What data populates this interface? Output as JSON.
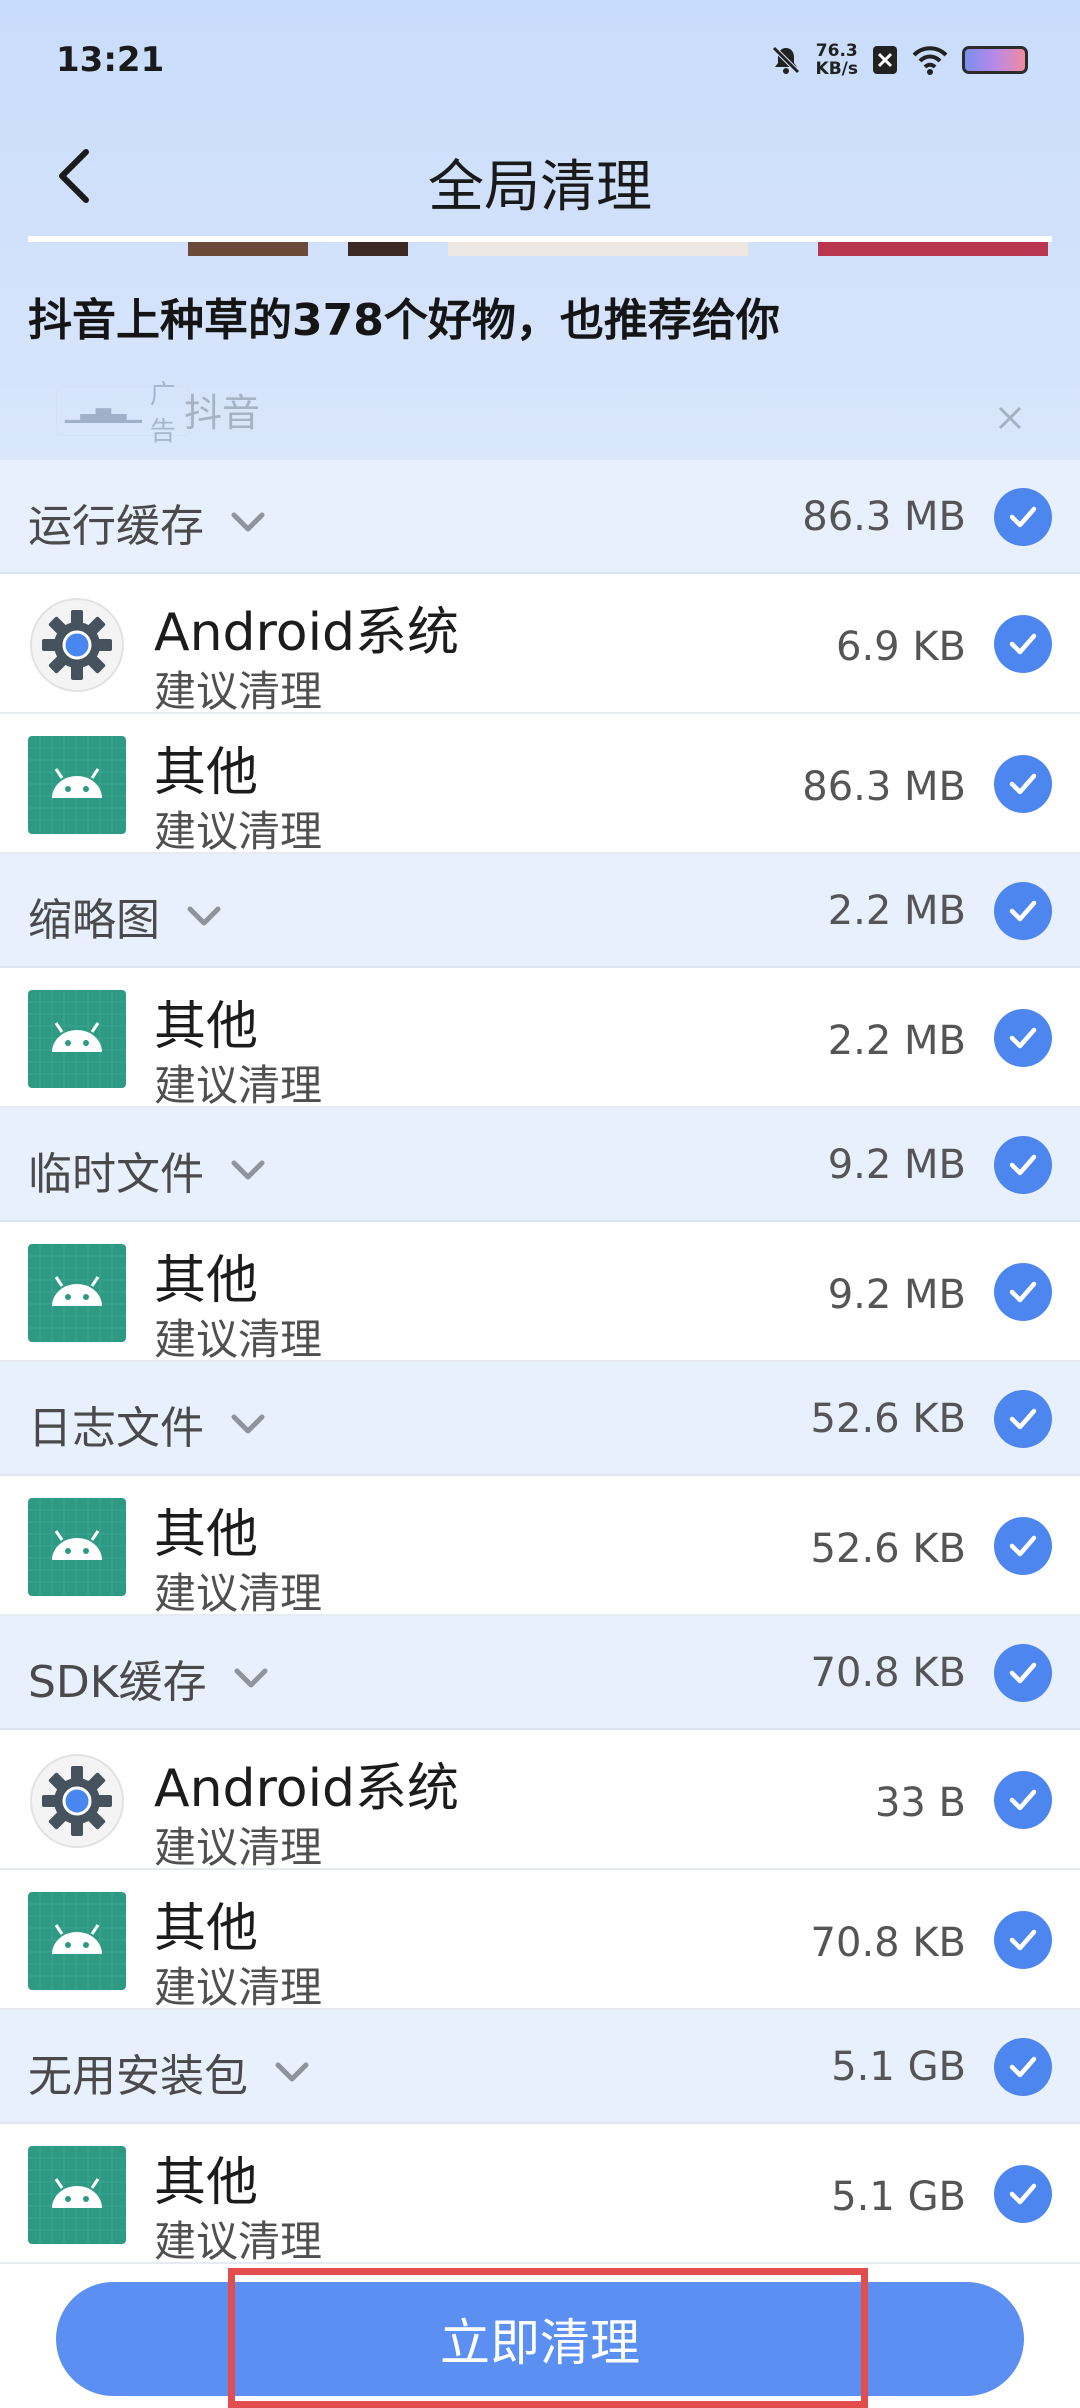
{
  "status_bar": {
    "time": "13:21",
    "net_speed_value": "76.3",
    "net_speed_unit": "KB/s"
  },
  "header": {
    "title": "全局清理"
  },
  "ad": {
    "title": "抖音上种草的378个好物，也推荐给你",
    "badge": "广告",
    "source": "抖音"
  },
  "categories": [
    {
      "label": "运行缓存",
      "size": "86.3 MB",
      "items": [
        {
          "name": "Android系统",
          "status": "建议清理",
          "size": "6.9 KB",
          "icon": "android-settings-icon"
        },
        {
          "name": "其他",
          "status": "建议清理",
          "size": "86.3 MB",
          "icon": "android-app-icon"
        }
      ]
    },
    {
      "label": "缩略图",
      "size": "2.2 MB",
      "items": [
        {
          "name": "其他",
          "status": "建议清理",
          "size": "2.2 MB",
          "icon": "android-app-icon"
        }
      ]
    },
    {
      "label": "临时文件",
      "size": "9.2 MB",
      "items": [
        {
          "name": "其他",
          "status": "建议清理",
          "size": "9.2 MB",
          "icon": "android-app-icon"
        }
      ]
    },
    {
      "label": "日志文件",
      "size": "52.6 KB",
      "items": [
        {
          "name": "其他",
          "status": "建议清理",
          "size": "52.6 KB",
          "icon": "android-app-icon"
        }
      ]
    },
    {
      "label": "SDK缓存",
      "size": "70.8 KB",
      "items": [
        {
          "name": "Android系统",
          "status": "建议清理",
          "size": "33 B",
          "icon": "android-settings-icon"
        },
        {
          "name": "其他",
          "status": "建议清理",
          "size": "70.8 KB",
          "icon": "android-app-icon"
        }
      ]
    },
    {
      "label": "无用安装包",
      "size": "5.1 GB",
      "items": [
        {
          "name": "其他",
          "status": "建议清理",
          "size": "5.1 GB",
          "icon": "android-app-icon"
        }
      ]
    }
  ],
  "actions": {
    "clean_label": "立即清理"
  },
  "colors": {
    "accent": "#5b8ff2",
    "check": "#4e86ef",
    "category_bg": "#e8f0fd",
    "highlight": "#e24d4d"
  }
}
